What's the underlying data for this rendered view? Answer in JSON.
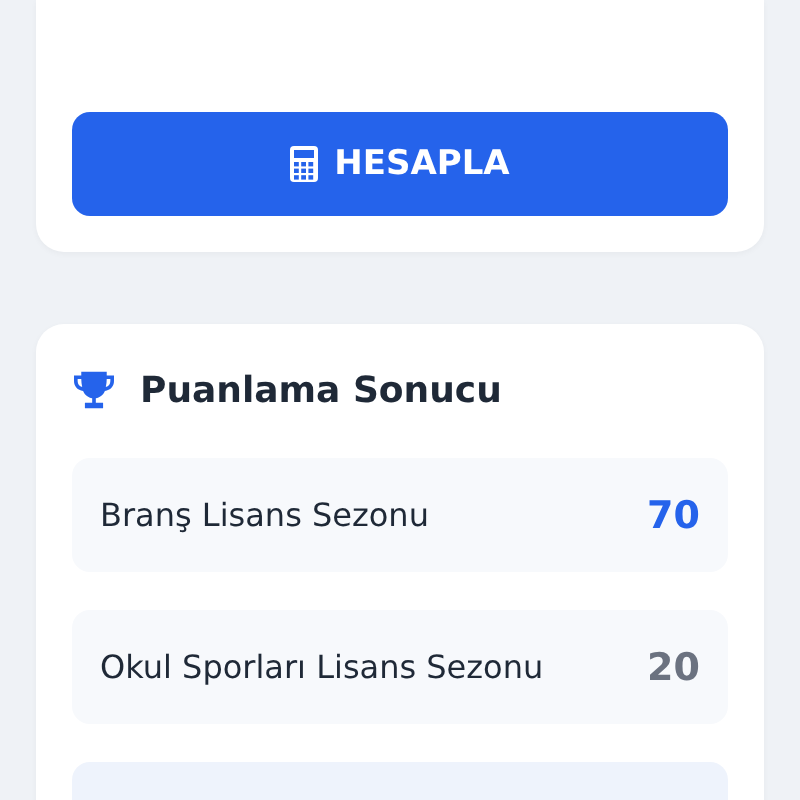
{
  "calculate_button": {
    "label": "HESAPLA"
  },
  "result": {
    "title": "Puanlama Sonucu",
    "rows": [
      {
        "label": "Branş Lisans Sezonu",
        "score": "70",
        "highlighted": true
      },
      {
        "label": "Okul Sporları Lisans Sezonu",
        "score": "20",
        "highlighted": false
      }
    ]
  }
}
